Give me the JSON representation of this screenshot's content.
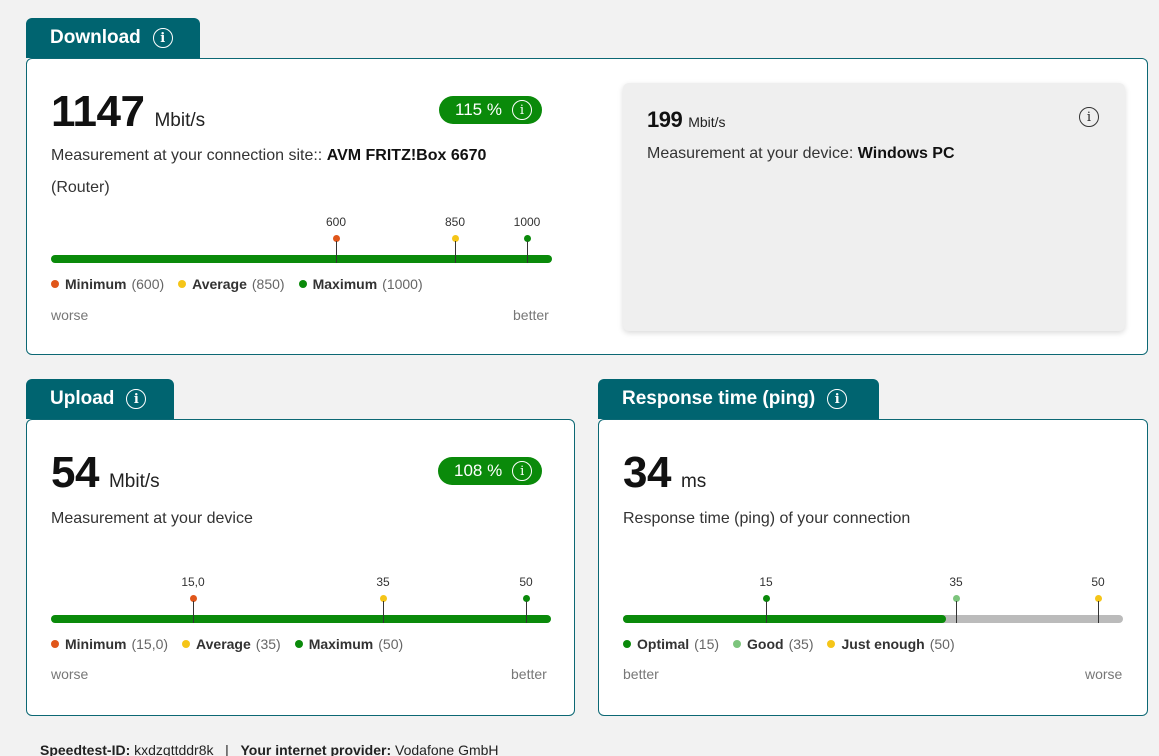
{
  "colors": {
    "teal": "#006470",
    "green": "#0a8a0a",
    "orange": "#e0561a",
    "yellow": "#f5c518",
    "lightgreen": "#7cc47c",
    "grey": "#bbbbbb"
  },
  "info_icon": "info-icon",
  "download": {
    "title": "Download",
    "value": "1147",
    "unit": "Mbit/s",
    "percent": "115 %",
    "site_label": "Measurement at your connection site::",
    "site_device": "AVM FRITZ!Box 6670",
    "site_type": "(Router)",
    "marker_labels": [
      "600",
      "850",
      "1000"
    ],
    "legend": [
      {
        "name": "Minimum",
        "value": "(600)"
      },
      {
        "name": "Average",
        "value": "(850)"
      },
      {
        "name": "Maximum",
        "value": "(1000)"
      }
    ],
    "left_edge": "worse",
    "right_edge": "better",
    "device": {
      "value": "199",
      "unit": "Mbit/s",
      "label": "Measurement at your device:",
      "name": "Windows PC"
    }
  },
  "upload": {
    "title": "Upload",
    "value": "54",
    "unit": "Mbit/s",
    "percent": "108 %",
    "desc": "Measurement at your device",
    "marker_labels": [
      "15,0",
      "35",
      "50"
    ],
    "legend": [
      {
        "name": "Minimum",
        "value": "(15,0)"
      },
      {
        "name": "Average",
        "value": "(35)"
      },
      {
        "name": "Maximum",
        "value": "(50)"
      }
    ],
    "left_edge": "worse",
    "right_edge": "better"
  },
  "ping": {
    "title": "Response time (ping)",
    "value": "34",
    "unit": "ms",
    "desc": "Response time (ping) of your connection",
    "marker_labels": [
      "15",
      "35",
      "50"
    ],
    "legend": [
      {
        "name": "Optimal",
        "value": "(15)"
      },
      {
        "name": "Good",
        "value": "(35)"
      },
      {
        "name": "Just enough",
        "value": "(50)"
      }
    ],
    "left_edge": "better",
    "right_edge": "worse"
  },
  "footer": {
    "id_label": "Speedtest-ID:",
    "id_value": "kxdzqttddr8k",
    "separator": "|",
    "provider_label": "Your internet provider:",
    "provider_value": "Vodafone GmbH"
  }
}
